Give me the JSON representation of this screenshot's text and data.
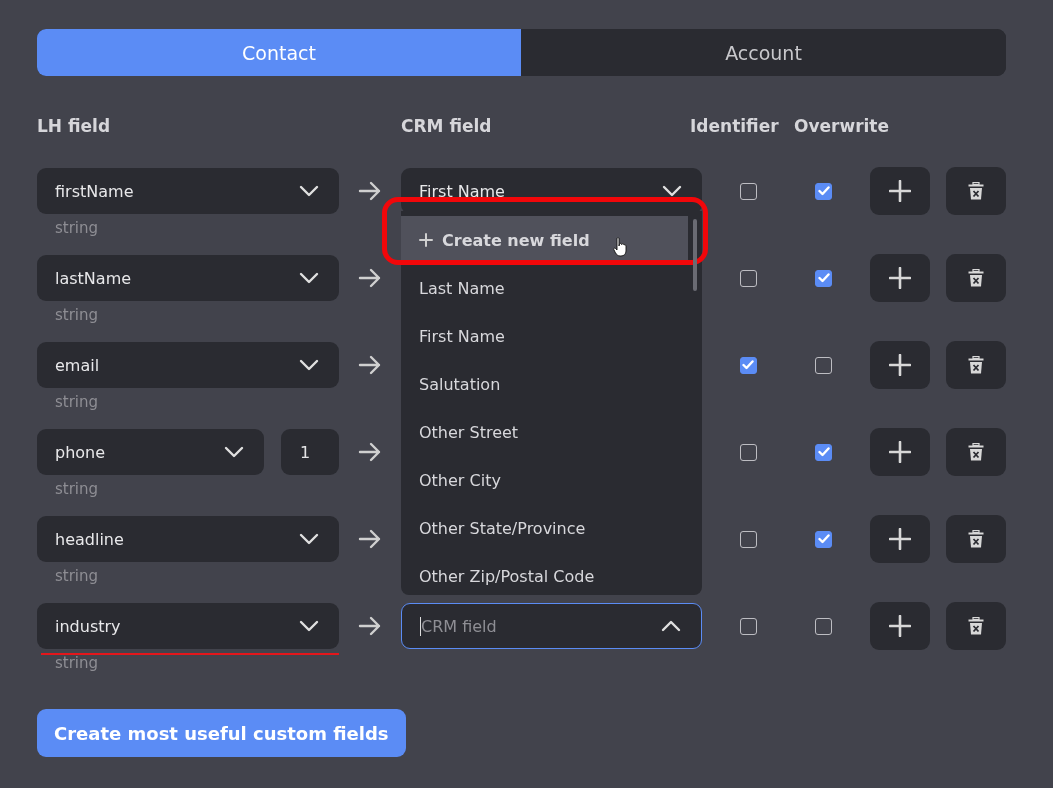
{
  "tabs": [
    {
      "label": "Contact",
      "selected": true
    },
    {
      "label": "Account",
      "selected": false
    }
  ],
  "headers": {
    "lh": "LH field",
    "crm": "CRM field",
    "identifier": "Identifier",
    "overwrite": "Overwrite"
  },
  "rows": [
    {
      "lh": "firstName",
      "type": "string",
      "crm": "First Name",
      "crm_expanded": false,
      "identifier": false,
      "overwrite": true,
      "error": false
    },
    {
      "lh": "lastName",
      "type": "string",
      "crm_expanded": false,
      "identifier": false,
      "overwrite": true,
      "error": false
    },
    {
      "lh": "email",
      "type": "string",
      "crm_expanded": false,
      "identifier": true,
      "overwrite": false,
      "error": false
    },
    {
      "lh": "phone",
      "type": "string",
      "count": "1",
      "crm_expanded": false,
      "identifier": false,
      "overwrite": true,
      "error": false
    },
    {
      "lh": "headline",
      "type": "string",
      "crm_expanded": false,
      "identifier": false,
      "overwrite": true,
      "error": false
    },
    {
      "lh": "industry",
      "type": "string",
      "crm_placeholder": "CRM field",
      "crm_expanded": true,
      "identifier": false,
      "overwrite": false,
      "error": true
    }
  ],
  "dropdown": {
    "options": [
      {
        "kind": "action",
        "label": "Create new field",
        "hovered": true,
        "highlighted": true
      },
      {
        "kind": "option",
        "label": "Last Name",
        "hovered": false,
        "highlighted": false
      },
      {
        "kind": "option",
        "label": "First Name",
        "hovered": false,
        "highlighted": false
      },
      {
        "kind": "option",
        "label": "Salutation",
        "hovered": false,
        "highlighted": false
      },
      {
        "kind": "option",
        "label": "Other Street",
        "hovered": false,
        "highlighted": false
      },
      {
        "kind": "option",
        "label": "Other City",
        "hovered": false,
        "highlighted": false
      },
      {
        "kind": "option",
        "label": "Other State/Province",
        "hovered": false,
        "highlighted": false
      },
      {
        "kind": "option",
        "label": "Other Zip/Postal Code",
        "hovered": false,
        "highlighted": false
      }
    ]
  },
  "footer_button": "Create most useful custom fields"
}
